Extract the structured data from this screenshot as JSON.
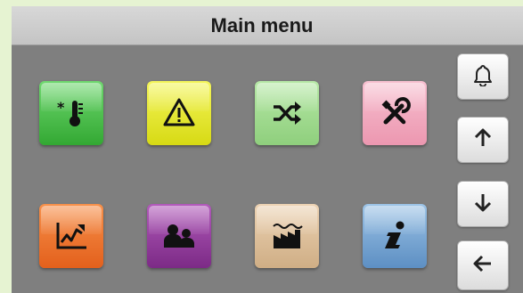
{
  "header": {
    "title": "Main menu"
  },
  "tiles": [
    {
      "name": "temperature",
      "icon": "thermometer-icon",
      "color": "#3fb43f"
    },
    {
      "name": "alarm",
      "icon": "warning-triangle-icon",
      "color": "#e4e630"
    },
    {
      "name": "mode",
      "icon": "shuffle-icon",
      "color": "#a2dc92"
    },
    {
      "name": "service",
      "icon": "tools-icon",
      "color": "#f1aac0"
    },
    {
      "name": "trend",
      "icon": "trend-chart-icon",
      "color": "#ea7230"
    },
    {
      "name": "users",
      "icon": "users-icon",
      "color": "#8f3a99"
    },
    {
      "name": "plant",
      "icon": "factory-icon",
      "color": "#dcbe98"
    },
    {
      "name": "info",
      "icon": "info-icon",
      "color": "#7aa9d6"
    }
  ],
  "sidebar": [
    {
      "name": "alarm-bell",
      "icon": "bell-icon"
    },
    {
      "name": "scroll-up",
      "icon": "arrow-up-icon"
    },
    {
      "name": "scroll-down",
      "icon": "arrow-down-icon"
    },
    {
      "name": "back",
      "icon": "arrow-left-icon"
    }
  ]
}
